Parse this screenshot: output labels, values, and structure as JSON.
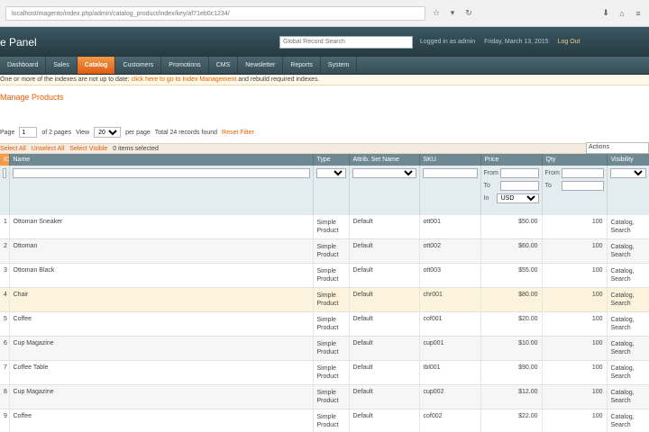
{
  "browser": {
    "url": "localhost/magento/index.php/admin/catalog_product/index/key/af71eb0c1234/"
  },
  "header": {
    "logo": "e Panel",
    "search_placeholder": "Global Record Search",
    "logged_in": "Logged in as admin",
    "date": "Friday, March 13, 2015",
    "logout": "Log Out"
  },
  "nav": [
    "Dashboard",
    "Sales",
    "Catalog",
    "Customers",
    "Promotions",
    "CMS",
    "Newsletter",
    "Reports",
    "System"
  ],
  "notice": {
    "text": "One or more of the indexes are not up to date:",
    "link": "click here to go to Index Management",
    "tail": "and rebuild required indexes."
  },
  "page_title": "Manage Products",
  "pager": {
    "page_label": "Page",
    "page_value": "1",
    "of_pages": "of 2 pages",
    "view_label": "View",
    "per_page": "20",
    "per_page_suffix": "per page",
    "total": "Total 24 records found",
    "reset": "Reset Filter"
  },
  "massaction": {
    "select_all": "Select All",
    "unselect_all": "Unselect All",
    "select_visible": "Select Visible",
    "items_selected": "0 items selected",
    "actions": "Actions"
  },
  "grid": {
    "columns": [
      "ID",
      "Name",
      "Type",
      "Attrib. Set Name",
      "SKU",
      "Price",
      "Qty",
      "Visibility"
    ],
    "range_from": "From",
    "range_to": "To",
    "currency_in": "In",
    "currency": "USD",
    "rows": [
      {
        "id": "1",
        "name": "Ottoman Sneaker",
        "type": "Simple Product",
        "set": "Default",
        "sku": "ott001",
        "price": "$50.00",
        "qty": "100",
        "visibility": "Catalog, Search"
      },
      {
        "id": "2",
        "name": "Ottoman",
        "type": "Simple Product",
        "set": "Default",
        "sku": "ott002",
        "price": "$60.00",
        "qty": "100",
        "visibility": "Catalog, Search"
      },
      {
        "id": "3",
        "name": "Ottoman Black",
        "type": "Simple Product",
        "set": "Default",
        "sku": "ott003",
        "price": "$55.00",
        "qty": "100",
        "visibility": "Catalog, Search"
      },
      {
        "id": "4",
        "name": "Chair",
        "type": "Simple Product",
        "set": "Default",
        "sku": "chr001",
        "price": "$80.00",
        "qty": "100",
        "visibility": "Catalog, Search"
      },
      {
        "id": "5",
        "name": "Coffee",
        "type": "Simple Product",
        "set": "Default",
        "sku": "cof001",
        "price": "$20.00",
        "qty": "100",
        "visibility": "Catalog, Search"
      },
      {
        "id": "6",
        "name": "Cup Magazine",
        "type": "Simple Product",
        "set": "Default",
        "sku": "cup001",
        "price": "$10.00",
        "qty": "100",
        "visibility": "Catalog, Search"
      },
      {
        "id": "7",
        "name": "Coffee Table",
        "type": "Simple Product",
        "set": "Default",
        "sku": "tbl001",
        "price": "$90.00",
        "qty": "100",
        "visibility": "Catalog, Search"
      },
      {
        "id": "8",
        "name": "Cup Magazine",
        "type": "Simple Product",
        "set": "Default",
        "sku": "cup002",
        "price": "$12.00",
        "qty": "100",
        "visibility": "Catalog, Search"
      },
      {
        "id": "9",
        "name": "Coffee",
        "type": "Simple Product",
        "set": "Default",
        "sku": "cof002",
        "price": "$22.00",
        "qty": "100",
        "visibility": "Catalog, Search"
      }
    ]
  }
}
